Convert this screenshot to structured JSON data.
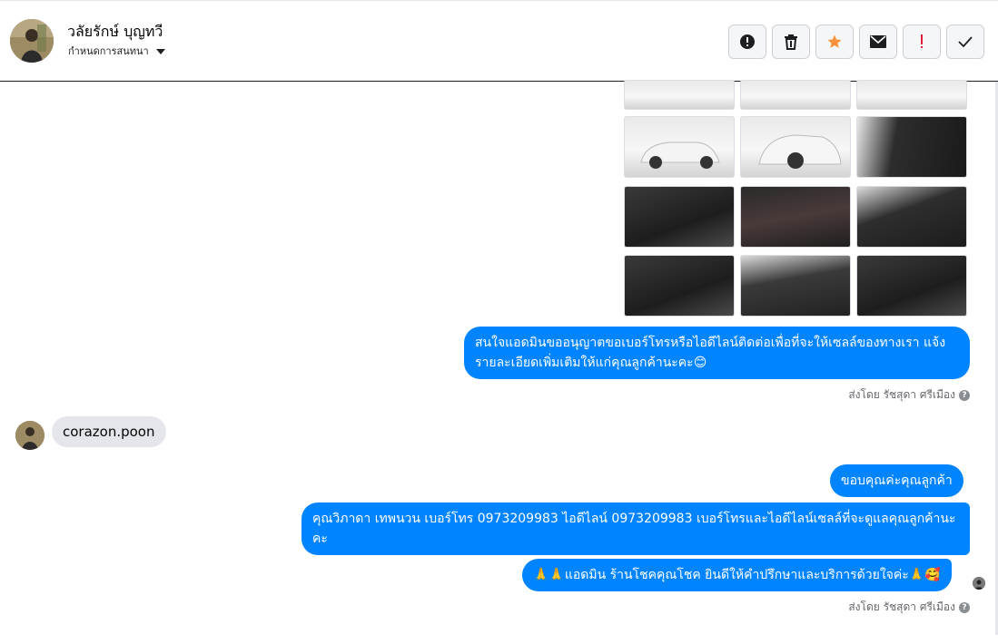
{
  "header": {
    "name": "วลัยรักษ์ บุญทวี",
    "subtitle": "กำหนดการสนทนา",
    "actions": [
      {
        "name": "report-icon",
        "color": "#1c1e21"
      },
      {
        "name": "trash-icon",
        "color": "#1c1e21"
      },
      {
        "name": "star-icon",
        "color": "#f7923a"
      },
      {
        "name": "envelope-icon",
        "color": "#1c1e21"
      },
      {
        "name": "urgent-icon",
        "color": "#e41e3f"
      },
      {
        "name": "check-icon",
        "color": "#1c1e21"
      }
    ]
  },
  "messages": {
    "outgoing_1": "สนใจแอดมินขออนุญาตขอเบอร์โทรหรือไอดีไลน์ติดต่อเพื่อที่จะให้เซลล์ของทางเรา แจ้งรายละเอียดเพิ่มเติมให้แก่คุณลูกค้านะคะ😊",
    "sent_by_1": "ส่งโดย รัชสุดา ศรีเมือง",
    "incoming_1": "corazon.poon",
    "outgoing_2": "ขอบคุณค่ะคุณลูกค้า",
    "outgoing_3": "คุณวิภาดา เทพนวน        เบอร์โทร 0973209983  ไอดีไลน์ 0973209983   เบอร์โทรและไอดีไลน์เซลล์ที่จะดูแลคุณลูกค้านะคะ",
    "outgoing_4": "🙏🙏แอดมิน ร้านโชคคุณโชค ยินดีให้คำปรึกษาและบริการด้วยใจค่ะ🙏🥰",
    "sent_by_2": "ส่งโดย รัชสุดา ศรีเมือง"
  },
  "colors": {
    "accent": "#0084ff",
    "incoming_bubble": "#e4e6eb"
  }
}
